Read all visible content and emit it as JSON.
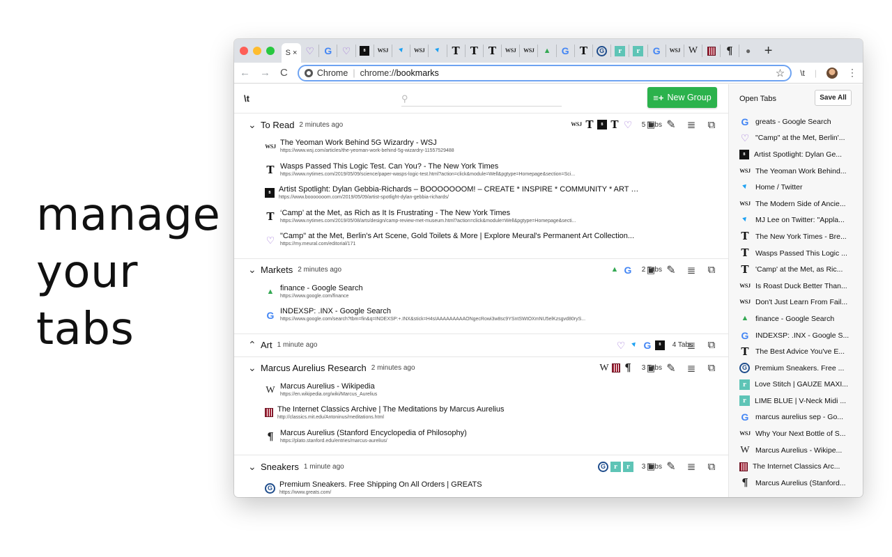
{
  "hero": {
    "line1": "manage",
    "line2": "your",
    "line3": "tabs"
  },
  "browser": {
    "active_tab_letter": "S",
    "active_tab_close": "×",
    "pinned_tabs": [
      {
        "icon": "meural-icon"
      },
      {
        "icon": "google-icon"
      },
      {
        "icon": "meural-icon"
      },
      {
        "icon": "booooooom-icon"
      },
      {
        "icon": "wsj-icon"
      },
      {
        "icon": "twitter-icon"
      },
      {
        "icon": "wsj-icon"
      },
      {
        "icon": "twitter-icon"
      },
      {
        "icon": "nyt-icon"
      },
      {
        "icon": "nyt-icon"
      },
      {
        "icon": "nyt-icon"
      },
      {
        "icon": "wsj-icon"
      },
      {
        "icon": "wsj-icon"
      },
      {
        "icon": "google-finance-icon"
      },
      {
        "icon": "google-icon"
      },
      {
        "icon": "nyt-icon"
      },
      {
        "icon": "greats-icon"
      },
      {
        "icon": "reformation-icon"
      },
      {
        "icon": "reformation-icon"
      },
      {
        "icon": "google-icon"
      },
      {
        "icon": "wsj-icon"
      },
      {
        "icon": "wikipedia-icon"
      },
      {
        "icon": "mit-classics-icon"
      },
      {
        "icon": "sep-icon"
      },
      {
        "icon": "apple-icon"
      }
    ],
    "new_tab": "+",
    "omnibox_chrome": "Chrome",
    "omnibox_url_prefix": "chrome://",
    "omnibox_url_bold": "bookmarks",
    "extension_label": "\\t"
  },
  "app": {
    "logo": "\\t",
    "search_placeholder": "",
    "new_group_label": "New Group",
    "groups": [
      {
        "name": "To Read",
        "time": "2 minutes ago",
        "count": "5 Tabs",
        "expanded": true,
        "favicons": [
          "wsj-icon",
          "nyt-icon",
          "booooooom-icon",
          "nyt-icon",
          "meural-icon"
        ],
        "items": [
          {
            "icon": "wsj-icon",
            "title": "The Yeoman Work Behind 5G Wizardry - WSJ",
            "url": "https://www.wsj.com/articles/the-yeoman-work-behind-5g-wizardry-11557529488"
          },
          {
            "icon": "nyt-icon",
            "title": "Wasps Passed This Logic Test. Can You? - The New York Times",
            "url": "https://www.nytimes.com/2019/05/09/science/paper-wasps-logic-test.html?action=click&module=Well&pgtype=Homepage&section=Sci..."
          },
          {
            "icon": "booooooom-icon",
            "title": "Artist Spotlight: Dylan Gebbia-Richards – BOOOOOOOM! – CREATE * INSPIRE * COMMUNITY * ART * ...",
            "url": "https://www.booooooom.com/2019/05/09/artist-spotlight-dylan-gebbia-richards/"
          },
          {
            "icon": "nyt-icon",
            "title": "‘Camp’ at the Met, as Rich as It Is Frustrating - The New York Times",
            "url": "https://www.nytimes.com/2019/05/08/arts/design/camp-review-met-museum.html?action=click&module=Well&pgtype=Homepage&secti..."
          },
          {
            "icon": "meural-icon",
            "title": "\"Camp\" at the Met, Berlin's Art Scene, Gold Toilets & More | Explore Meural's Permanent Art Collection...",
            "url": "https://my.meural.com/editorial/171"
          }
        ]
      },
      {
        "name": "Markets",
        "time": "2 minutes ago",
        "count": "2 Tabs",
        "expanded": true,
        "favicons": [
          "google-finance-icon",
          "google-icon"
        ],
        "items": [
          {
            "icon": "google-finance-icon",
            "title": "finance - Google Search",
            "url": "https://www.google.com/finance"
          },
          {
            "icon": "google-icon",
            "title": "INDEXSP: .INX - Google Search",
            "url": "https://www.google.com/search?tbm=fin&q=INDEXSP:+.INX&stick=H4sIAAAAAAAAAONgecRowi3w8sc9YSntSWtOXmNU5elKzsgvd80ryS..."
          }
        ]
      },
      {
        "name": "Art",
        "time": "1 minute ago",
        "count": "4 Tabs",
        "expanded": false,
        "favicons": [
          "meural-icon",
          "twitter-icon",
          "google-icon",
          "booooooom-icon"
        ],
        "items": []
      },
      {
        "name": "Marcus Aurelius Research",
        "time": "2 minutes ago",
        "count": "3 Tabs",
        "expanded": true,
        "favicons": [
          "wikipedia-icon",
          "mit-classics-icon",
          "sep-icon"
        ],
        "items": [
          {
            "icon": "wikipedia-icon",
            "title": "Marcus Aurelius - Wikipedia",
            "url": "https://en.wikipedia.org/wiki/Marcus_Aurelius"
          },
          {
            "icon": "mit-classics-icon",
            "title": "The Internet Classics Archive | The Meditations by Marcus Aurelius",
            "url": "http://classics.mit.edu/Antoninus/meditations.html"
          },
          {
            "icon": "sep-icon",
            "title": "Marcus Aurelius (Stanford Encyclopedia of Philosophy)",
            "url": "https://plato.stanford.edu/entries/marcus-aurelius/"
          }
        ]
      },
      {
        "name": "Sneakers",
        "time": "1 minute ago",
        "count": "3 Tabs",
        "expanded": true,
        "favicons": [
          "greats-icon",
          "reformation-icon",
          "reformation-icon"
        ],
        "items": [
          {
            "icon": "greats-icon",
            "title": "Premium Sneakers. Free Shipping On All Orders | GREATS",
            "url": "https://www.greats.com/"
          }
        ]
      }
    ]
  },
  "sidebar": {
    "title": "Open Tabs",
    "save_all": "Save All",
    "tabs": [
      {
        "icon": "google-icon",
        "label": "greats - Google Search"
      },
      {
        "icon": "meural-icon",
        "label": "\"Camp\" at the Met, Berlin'..."
      },
      {
        "icon": "booooooom-icon",
        "label": "Artist Spotlight: Dylan Ge..."
      },
      {
        "icon": "wsj-icon",
        "label": "The Yeoman Work Behind..."
      },
      {
        "icon": "twitter-icon",
        "label": "Home / Twitter"
      },
      {
        "icon": "wsj-icon",
        "label": "The Modern Side of Ancie..."
      },
      {
        "icon": "twitter-icon",
        "label": "MJ Lee on Twitter: \"Appla..."
      },
      {
        "icon": "nyt-icon",
        "label": "The New York Times - Bre..."
      },
      {
        "icon": "nyt-icon",
        "label": "Wasps Passed This Logic ..."
      },
      {
        "icon": "nyt-icon",
        "label": "'Camp' at the Met, as Ric..."
      },
      {
        "icon": "wsj-icon",
        "label": "Is Roast Duck Better Than..."
      },
      {
        "icon": "wsj-icon",
        "label": "Don't Just Learn From Fail..."
      },
      {
        "icon": "google-finance-icon",
        "label": "finance - Google Search"
      },
      {
        "icon": "google-icon",
        "label": "INDEXSP: .INX - Google S..."
      },
      {
        "icon": "nyt-icon",
        "label": "The Best Advice You've E..."
      },
      {
        "icon": "greats-icon",
        "label": "Premium Sneakers. Free ..."
      },
      {
        "icon": "reformation-icon",
        "label": "Love Stitch | GAUZE MAXI..."
      },
      {
        "icon": "reformation-icon",
        "label": "LIME BLUE | V-Neck Midi ..."
      },
      {
        "icon": "google-icon",
        "label": "marcus aurelius sep - Go..."
      },
      {
        "icon": "wsj-icon",
        "label": "Why Your Next Bottle of S..."
      },
      {
        "icon": "wikipedia-icon",
        "label": "Marcus Aurelius - Wikipe..."
      },
      {
        "icon": "mit-classics-icon",
        "label": "The Internet Classics Arc..."
      },
      {
        "icon": "sep-icon",
        "label": "Marcus Aurelius (Stanford..."
      }
    ]
  },
  "colors": {
    "new_group_green": "#2bb24c",
    "traffic_red": "#fe5f57",
    "traffic_yellow": "#febc2e",
    "traffic_green": "#28c840",
    "omnibox_focus": "#6ea3f1"
  }
}
